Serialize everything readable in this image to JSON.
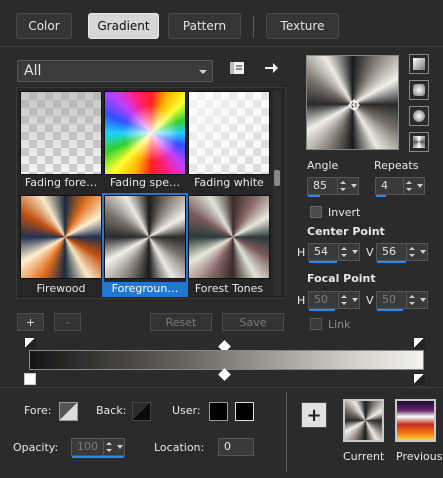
{
  "tabs": [
    {
      "label": "Color",
      "active": false
    },
    {
      "label": "Gradient",
      "active": true
    },
    {
      "label": "Pattern",
      "active": false
    },
    {
      "label": "Texture",
      "active": false
    }
  ],
  "category": {
    "selected": "All"
  },
  "gallery": {
    "items": [
      {
        "label": "Fading fore…",
        "pattern": "checker-fade"
      },
      {
        "label": "Fading spe…",
        "pattern": "rainbow-burst"
      },
      {
        "label": "Fading white",
        "pattern": "checker-white"
      },
      {
        "label": "Firewood",
        "pattern": "orange-navy-burst"
      },
      {
        "label": "Foregroun…",
        "pattern": "gray-burst",
        "selected": true
      },
      {
        "label": "Forest Tones",
        "pattern": "earth-burst"
      }
    ]
  },
  "gallery_buttons": {
    "add": "+",
    "remove": "-",
    "reset": "Reset",
    "save": "Save"
  },
  "angle": {
    "label": "Angle",
    "value": "85"
  },
  "repeats": {
    "label": "Repeats",
    "value": "4"
  },
  "invert": {
    "label": "Invert",
    "checked": false
  },
  "center_point": {
    "label": "Center Point",
    "h_label": "H",
    "h": "54",
    "v_label": "V",
    "v": "56"
  },
  "focal_point": {
    "label": "Focal Point",
    "h_label": "H",
    "h": "50",
    "v_label": "V",
    "v": "50"
  },
  "link": {
    "label": "Link",
    "checked": false
  },
  "bottom": {
    "fore_label": "Fore:",
    "back_label": "Back:",
    "user_label": "User:",
    "opacity_label": "Opacity:",
    "opacity_value": "100",
    "location_label": "Location:",
    "location_value": "0",
    "add_button": "+",
    "current_label": "Current",
    "previous_label": "Previous"
  },
  "colors": {
    "accent": "#1e78d6",
    "panel": "#2b2b2b",
    "user_swatch": "#000000"
  },
  "icons": [
    "caret-down-icon",
    "book-icon",
    "arrow-right-icon",
    "square-icon",
    "rounded-square-icon",
    "circle-icon",
    "rectangle-icon",
    "stop-swap-icon",
    "diamond-marker-icon"
  ]
}
